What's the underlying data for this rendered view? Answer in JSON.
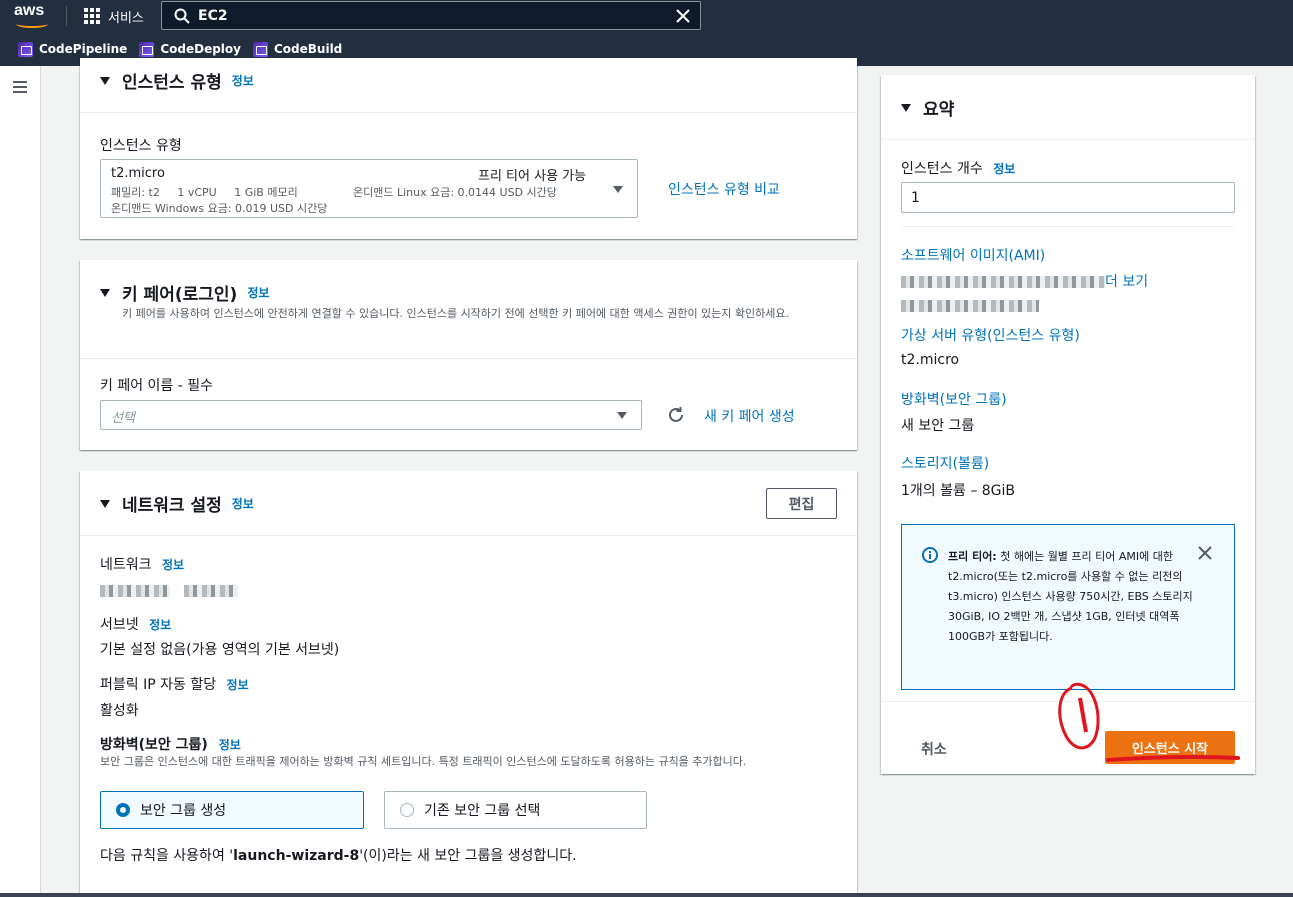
{
  "topnav": {
    "logo": "aws",
    "services_label": "서비스",
    "search_value": "EC2",
    "favorites": [
      "CodePipeline",
      "CodeDeploy",
      "CodeBuild"
    ]
  },
  "instance_type": {
    "title": "인스턴스 유형",
    "info": "정보",
    "field_label": "인스턴스 유형",
    "selected": "t2.micro",
    "free_tier_badge": "프리 티어 사용 가능",
    "detail1": "패밀리: t2     1 vCPU     1 GiB 메모리",
    "detail1_price": "온디맨드 Linux 요금: 0.0144 USD 시간당",
    "detail2": "온디맨드 Windows 요금: 0.019 USD 시간당",
    "compare_link": "인스턴스 유형 비교"
  },
  "key_pair": {
    "title": "키 페어(로그인)",
    "info": "정보",
    "description": "키 페어를 사용하여 인스턴스에 안전하게 연결할 수 있습니다. 인스턴스를 시작하기 전에 선택한 키 페어에 대한 액세스 권한이 있는지 확인하세요.",
    "field_label": "키 페어 이름 - 필수",
    "placeholder": "선택",
    "create_link": "새 키 페어 생성"
  },
  "network": {
    "title": "네트워크 설정",
    "info": "정보",
    "edit_button": "편집",
    "network_label": "네트워크",
    "subnet_label": "서브넷",
    "subnet_value": "기본 설정 없음(가용 영역의 기본 서브넷)",
    "public_ip_label": "퍼블릭 IP 자동 할당",
    "public_ip_value": "활성화",
    "firewall_label": "방화벽(보안 그룹)",
    "firewall_desc": "보안 그룹은 인스턴스에 대한 트래픽을 제어하는 방화벽 규칙 세트입니다. 특정 트래픽이 인스턴스에 도달하도록 허용하는 규칙을 추가합니다.",
    "option_create": "보안 그룹 생성",
    "option_existing": "기존 보안 그룹 선택",
    "rule_prefix": "다음 규칙을 사용하여 '",
    "rule_name": "launch-wizard-8",
    "rule_suffix": "'(이)라는 새 보안 그룹을 생성합니다."
  },
  "summary": {
    "title": "요약",
    "count_label": "인스턴스 개수",
    "info": "정보",
    "count_value": "1",
    "ami_label": "소프트웨어 이미지(AMI)",
    "ami_more": "더 보기",
    "type_label": "가상 서버 유형(인스턴스 유형)",
    "type_value": "t2.micro",
    "firewall_label": "방화벽(보안 그룹)",
    "firewall_value": "새 보안 그룹",
    "storage_label": "스토리지(볼륨)",
    "storage_value": "1개의 볼륨 – 8GiB",
    "free_tier_bold": "프리 티어:",
    "free_tier_text": " 첫 해에는 월별 프리 티어 AMI에 대한 t2.micro(또는 t2.micro를 사용할 수 없는 리전의 t3.micro) 인스턴스 사용량 750시간, EBS 스토리지 30GiB, IO 2백만 개, 스냅샷 1GB, 인터넷 대역폭 100GB가 포함됩니다.",
    "cancel": "취소",
    "launch": "인스턴스 시작"
  },
  "colors": {
    "nav_bg": "#232f3e",
    "link": "#0073bb",
    "primary": "#ec7211",
    "annotation": "#e0161e"
  }
}
